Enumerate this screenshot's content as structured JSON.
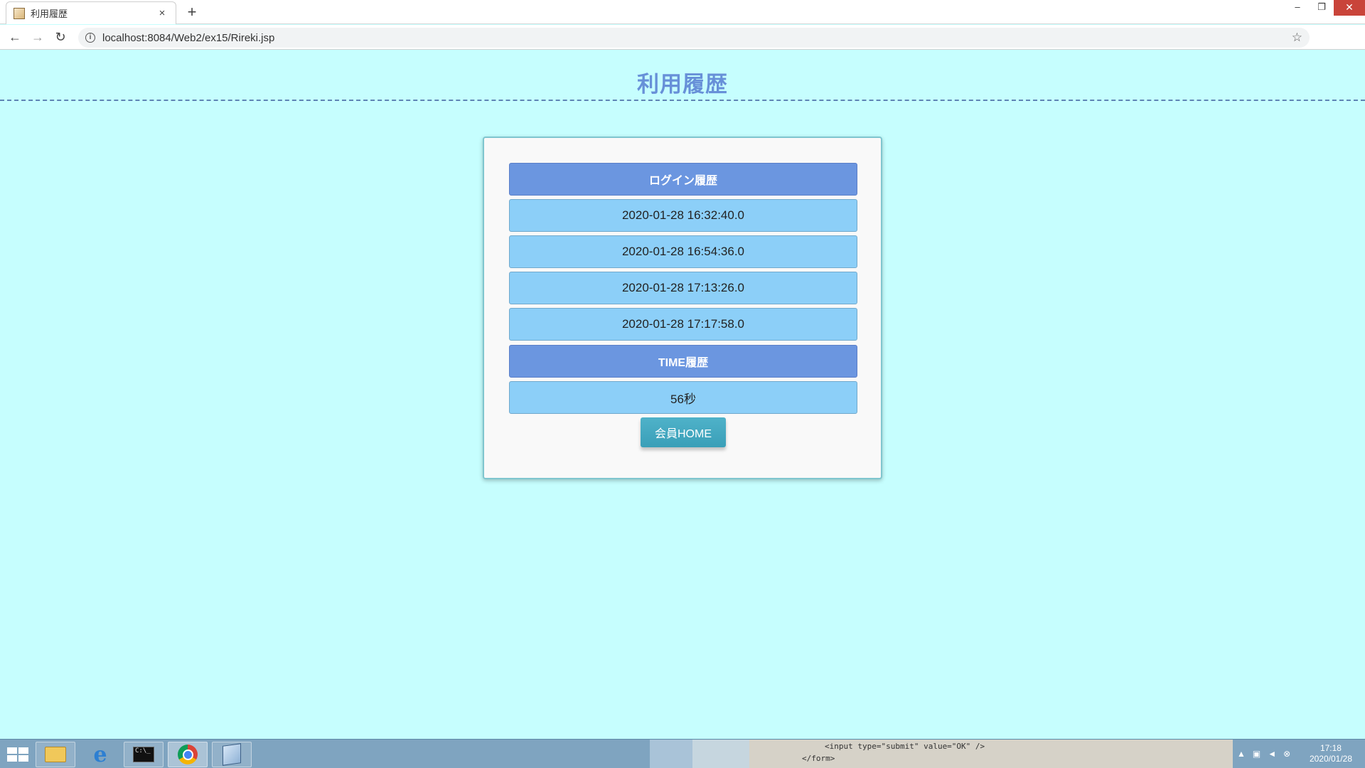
{
  "browser": {
    "tab_title": "利用履歴",
    "tab_close": "×",
    "new_tab": "+",
    "url": "localhost:8084/Web2/ex15/Rireki.jsp",
    "window_controls": {
      "minimize": "–",
      "restore": "❐",
      "close": "✕"
    },
    "nav": {
      "back": "←",
      "forward": "→",
      "reload": "↻"
    },
    "star": "☆",
    "info": "i"
  },
  "page": {
    "title": "利用履歴",
    "login_header": "ログイン履歴",
    "login_history": [
      "2020-01-28 16:32:40.0",
      "2020-01-28 16:54:36.0",
      "2020-01-28 17:13:26.0",
      "2020-01-28 17:17:58.0"
    ],
    "time_header": "TIME履歴",
    "time_value": "56秒",
    "home_button": "会員HOME"
  },
  "taskbar": {
    "code_line1": "<input type=\"submit\" value=\"OK\" />",
    "code_line2": "</form>",
    "clock_time": "17:18",
    "clock_date": "2020/01/28",
    "cmd_label": "C:\\_"
  },
  "colors": {
    "page_background": "#c6fefe",
    "title": "#6790d8",
    "header_row": "#6b96e0",
    "data_row": "#8ccff8",
    "home_button": "#4fb2c9"
  }
}
